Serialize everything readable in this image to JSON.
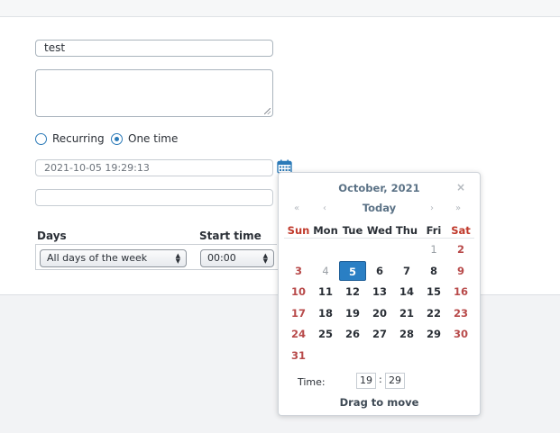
{
  "form": {
    "title_value": "test",
    "description_value": "",
    "schedule_options": [
      {
        "label": "Recurring",
        "selected": false
      },
      {
        "label": "One time",
        "selected": true
      }
    ],
    "datetime_placeholder": "2021-10-05 19:29:13",
    "extra_value": "",
    "table": {
      "headers": [
        "Days",
        "Start time"
      ],
      "days_selected": "All days of the week",
      "start_time_selected": "00:00"
    }
  },
  "calendar": {
    "month_title": "October, 2021",
    "close": "×",
    "nav": {
      "prev_year": "«",
      "prev_month": "‹",
      "today": "Today",
      "next_month": "›",
      "next_year": "»"
    },
    "weekdays": [
      "Sun",
      "Mon",
      "Tue",
      "Wed",
      "Thu",
      "Fri",
      "Sat"
    ],
    "weeks": [
      [
        "",
        "",
        "",
        "",
        "",
        "1",
        "2"
      ],
      [
        "3",
        "4",
        "5",
        "6",
        "7",
        "8",
        "9"
      ],
      [
        "10",
        "11",
        "12",
        "13",
        "14",
        "15",
        "16"
      ],
      [
        "17",
        "18",
        "19",
        "20",
        "21",
        "22",
        "23"
      ],
      [
        "24",
        "25",
        "26",
        "27",
        "28",
        "29",
        "30"
      ],
      [
        "31",
        "",
        "",
        "",
        "",
        "",
        ""
      ]
    ],
    "selected_day": "5",
    "time_label": "Time:",
    "hour": "19",
    "time_separator": ":",
    "minute": "29",
    "footer": "Drag to move"
  },
  "colors": {
    "accent": "#2a7fc4",
    "weekend": "#c0392b"
  },
  "icons": {
    "calendar_button": "calendar-icon"
  }
}
